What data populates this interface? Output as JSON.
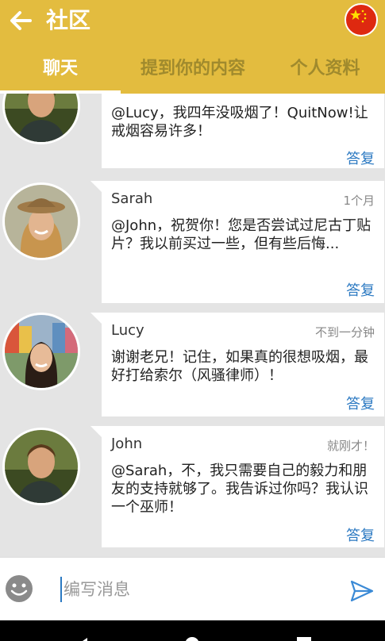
{
  "header": {
    "title": "社区"
  },
  "tabs": [
    {
      "label": "聊天"
    },
    {
      "label": "提到你的内容"
    },
    {
      "label": "个人资料"
    }
  ],
  "messages": [
    {
      "author": "",
      "time": "",
      "text": "@Lucy，我四年没吸烟了！QuitNow!让戒烟容易许多！",
      "reply": "答复"
    },
    {
      "author": "Sarah",
      "time": "1个月",
      "text": "@John，祝贺你！您是否尝试过尼古丁贴片？我以前买过一些，但有些后悔...",
      "reply": "答复"
    },
    {
      "author": "Lucy",
      "time": "不到一分钟",
      "text": "谢谢老兄！记住，如果真的很想吸烟，最好打给索尔（风骚律师）！",
      "reply": "答复"
    },
    {
      "author": "John",
      "time": "就刚才！",
      "text": "@Sarah，不，我只需要自己的毅力和朋友的支持就够了。我告诉过你吗？我认识一个巫师！",
      "reply": "答复"
    }
  ],
  "composer": {
    "placeholder": "编写消息"
  }
}
